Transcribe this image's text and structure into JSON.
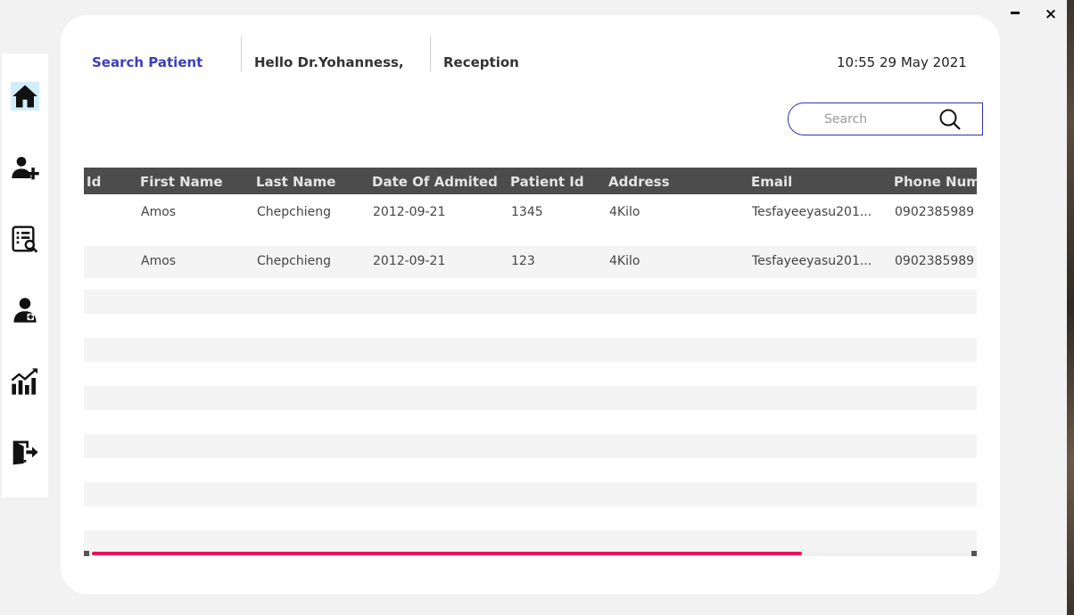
{
  "window": {
    "minimize_icon": "minimize-icon",
    "close_label": "×"
  },
  "sidebar": {
    "items": [
      {
        "icon": "home-icon",
        "active": true
      },
      {
        "icon": "add-user-icon",
        "active": false
      },
      {
        "icon": "search-list-icon",
        "active": false
      },
      {
        "icon": "doctor-icon",
        "active": false
      },
      {
        "icon": "chart-icon",
        "active": false
      },
      {
        "icon": "logout-icon",
        "active": false
      }
    ]
  },
  "header": {
    "search_patient": "Search Patient",
    "greeting": "Hello Dr.Yohanness,",
    "role": "Reception",
    "datetime": "10:55 29 May 2021"
  },
  "search": {
    "placeholder": "Search",
    "icon": "search-icon"
  },
  "table": {
    "columns": [
      "Id",
      "First Name",
      "Last Name",
      "Date Of Admited",
      "Patient Id",
      "Address",
      "Email",
      "Phone Num"
    ],
    "rows": [
      {
        "id": "",
        "first": "Amos",
        "last": "Chepchieng",
        "date": "2012-09-21",
        "pid": "1345",
        "address": "4Kilo",
        "email": "Tesfayeeyasu201...",
        "phone": "0902385989"
      },
      {
        "id": "",
        "first": "Amos",
        "last": "Chepchieng",
        "date": "2012-09-21",
        "pid": "123",
        "address": "4Kilo",
        "email": "Tesfayeeyasu201...",
        "phone": "0902385989"
      }
    ]
  },
  "colors": {
    "accent": "#3a3fb5",
    "header_bg": "#4c4c4c",
    "scroll_thumb": "#e8145a",
    "active_nav": "#cfeef9"
  }
}
